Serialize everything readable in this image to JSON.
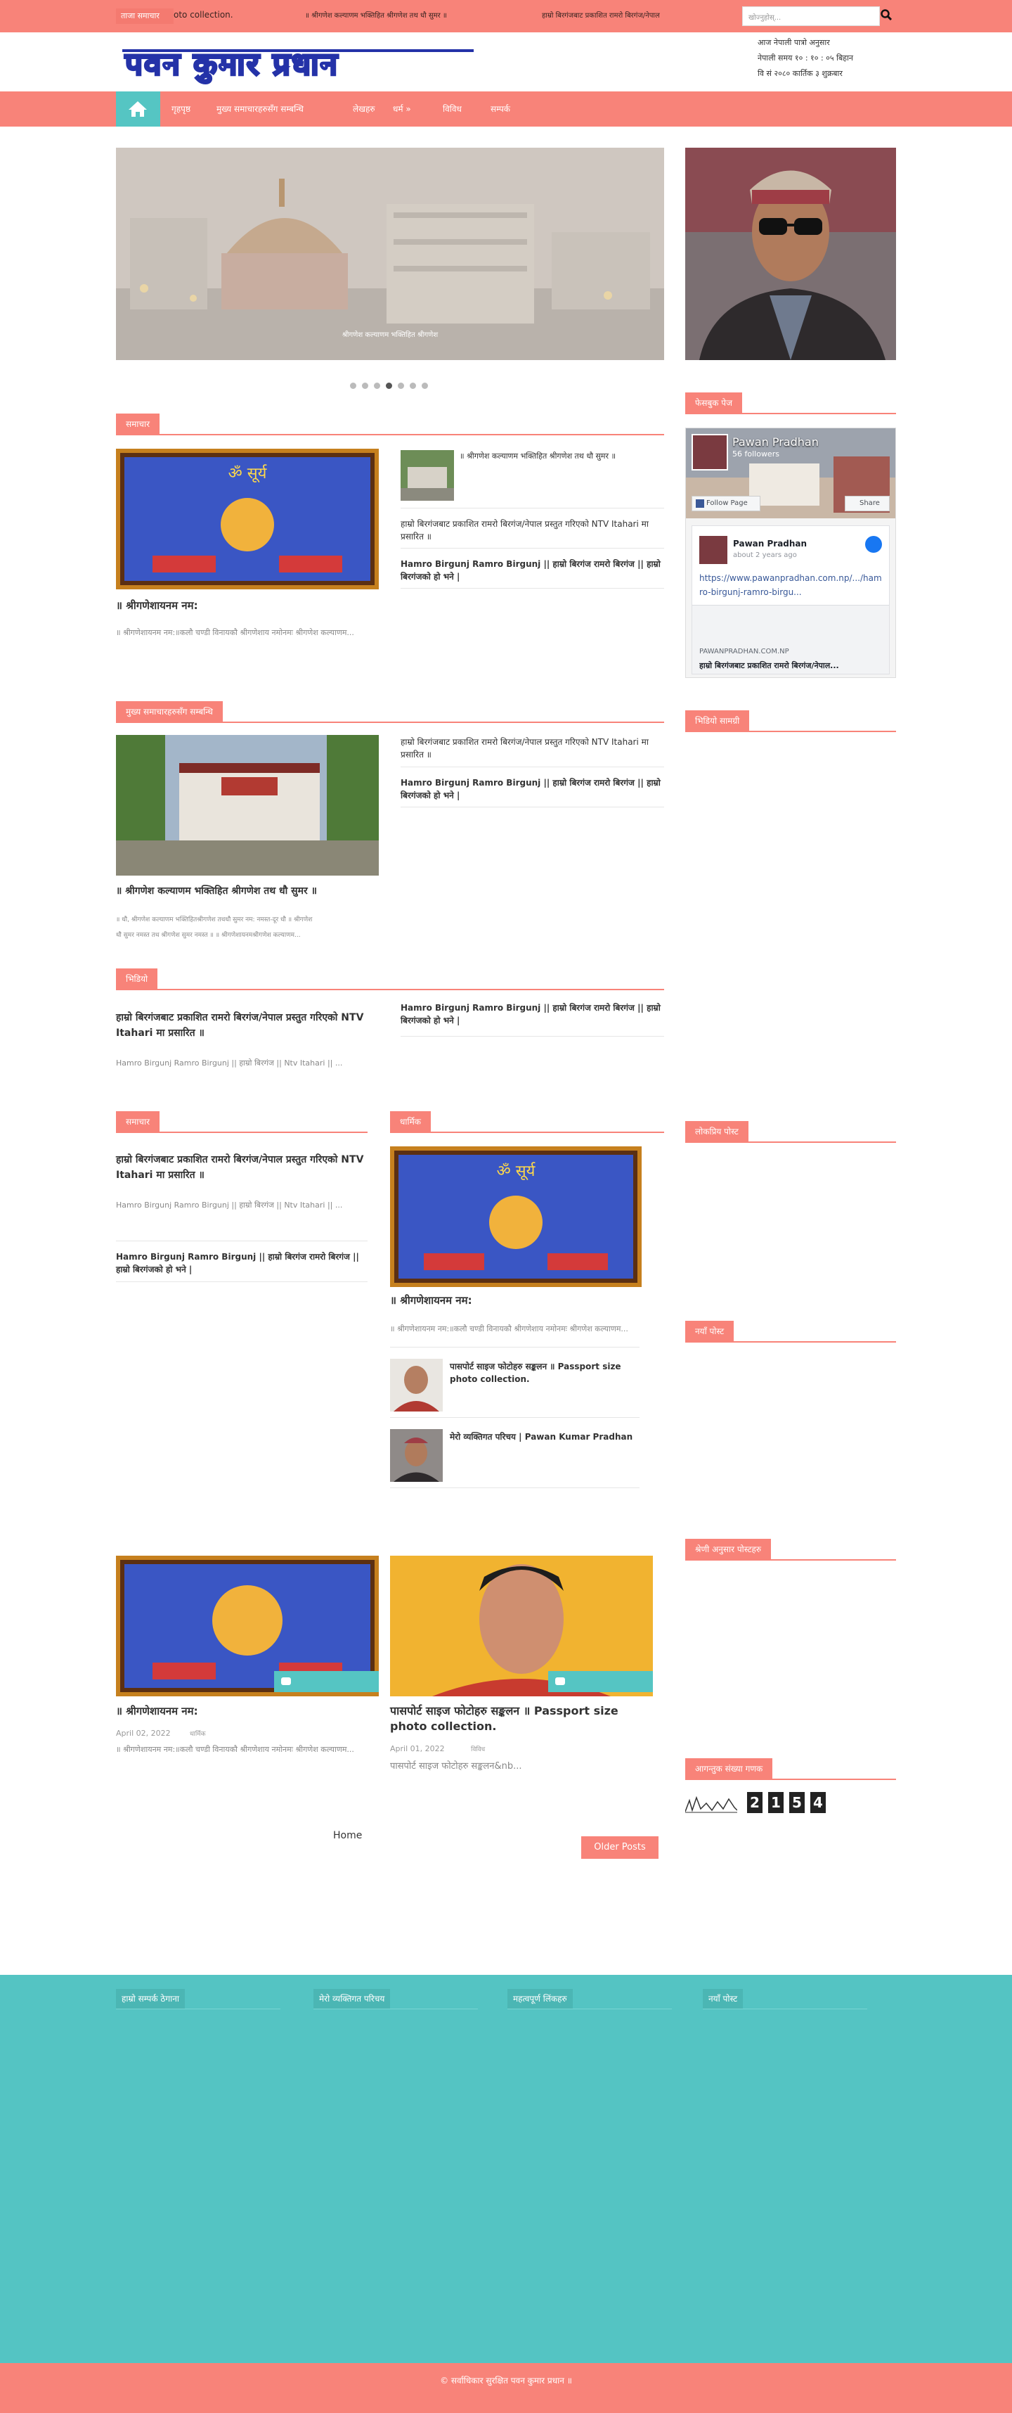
{
  "topbar": {
    "ticker_label": "ताजा समाचार",
    "ticker_items": [
      "oto collection.",
      "॥ श्रीगणेश कल्याणम भक्तिहित श्रीगणेश तथ धौ सुमर ॥",
      "हाम्रो बिरगंजबाट प्रकाशित रामरो बिरगंज/नेपाल"
    ],
    "search_placeholder": "खोज्नुहोस्..."
  },
  "header": {
    "logo_text": "पवन कुमार प्रधान",
    "date_line1": "आज नेपाली पात्रो अनुसार",
    "date_line2": "नेपाली समय १० : १० : ०५ बिहान",
    "date_line3": "वि सं २०८० कार्तिक ३ शुक्रबार"
  },
  "nav": {
    "items": [
      "गृहपृष्ठ",
      "मुख्य समाचारहरुसँग सम्बन्धि",
      "लेखहरु",
      "धर्म »",
      "विविध",
      "सम्पर्क"
    ]
  },
  "slider": {
    "caption": "श्रीगणेश कल्याणम भक्तिहित श्रीगणेश",
    "dots": 7,
    "active_dot": 4
  },
  "section1": {
    "heading": "समाचार",
    "main_title": "॥ श्रीगणेशायनम नम:",
    "main_excerpt": "॥ श्रीगणेशायनम नम:॥कलौ चण्डी विनायकौ श्रीगणेशाय नमोनमः श्रीगणेश कल्याणम...",
    "side_items": [
      "॥ श्रीगणेश कल्याणम भक्तिहित श्रीगणेश तथ धौ सुमर ॥",
      "हाम्रो बिरगंजबाट प्रकाशित रामरो बिरगंज/नेपाल प्रस्तुत गरिएको NTV Itahari मा प्रसारित ॥",
      "Hamro Birgunj Ramro Birgunj || हाम्रो बिरगंज रामरो बिरगंज || हाम्रो बिरगंजको हो भने |"
    ]
  },
  "section2": {
    "heading": "मुख्य समाचारहरुसँग सम्बन्धि",
    "main_title": "॥ श्रीगणेश कल्याणम भक्तिहित श्रीगणेश तथ धौ सुमर ॥",
    "main_excerpt_1": "॥ धौ, श्रीगणेश कल्याणम भक्तिहितश्रीगणेश तथधौ सुमर नम: नमस्त-दूर धौ ॥ श्रीगणेश",
    "main_excerpt_2": "धौ सुमर नमस्त तथ श्रीगणेश सुमर नमस्त ॥ ॥ श्रीगणेशायनमश्रीगणेश कल्याणम...",
    "side_items": [
      "हाम्रो बिरगंजबाट प्रकाशित रामरो बिरगंज/नेपाल प्रस्तुत गरिएको NTV Itahari मा प्रसारित ॥",
      "Hamro Birgunj Ramro Birgunj || हाम्रो बिरगंज रामरो बिरगंज || हाम्रो बिरगंजको हो भने |"
    ]
  },
  "section3": {
    "heading": "भिडियो",
    "main_title": "हाम्रो बिरगंजबाट प्रकाशित रामरो बिरगंज/नेपाल प्रस्तुत गरिएको NTV Itahari मा प्रसारित ॥",
    "main_excerpt": "Hamro Birgunj Ramro Birgunj || हाम्रो बिरगंज || Ntv Itahari || ...",
    "side_item": "Hamro Birgunj Ramro Birgunj || हाम्रो बिरगंज रामरो बिरगंज || हाम्रो बिरगंजको हो भने |"
  },
  "section4": {
    "heading": "समाचार",
    "main_title": "हाम्रो बिरगंजबाट प्रकाशित रामरो बिरगंज/नेपाल प्रस्तुत गरिएको NTV Itahari मा प्रसारित ॥",
    "main_excerpt": "Hamro Birgunj Ramro Birgunj || हाम्रो बिरगंज || Ntv Itahari || ...",
    "side_item": "Hamro Birgunj Ramro Birgunj || हाम्रो बिरगंज रामरो बिरगंज || हाम्रो बिरगंजको हो भने |"
  },
  "section5": {
    "heading": "धार्मिक",
    "main_title": "॥ श्रीगणेशायनम नम:",
    "main_excerpt": "॥ श्रीगणेशायनम नम:॥कलौ चण्डी विनायकौ श्रीगणेशाय नमोनमः श्रीगणेश कल्याणम...",
    "list": [
      "पासपोर्ट साइज फोटोहरु सङ्कलन ॥ Passport size photo collection.",
      "मेरो व्यक्तिगत परिचय | Pawan Kumar Pradhan"
    ]
  },
  "posts": [
    {
      "title": "॥ श्रीगणेशायनम नम:",
      "date": "April 02, 2022",
      "category": "धार्मिक",
      "excerpt": "॥ श्रीगणेशायनम नम:॥कलौ चण्डी विनायकौ श्रीगणेशाय नमोनमः श्रीगणेश कल्याणम..."
    },
    {
      "title": "पासपोर्ट साइज फोटोहरु सङ्कलन ॥ Passport size photo collection.",
      "date": "April 01, 2022",
      "category": "विविध",
      "excerpt": "पासपोर्ट साइज फोटोहरु सङ्कलन&nb..."
    }
  ],
  "pagination": {
    "home": "Home",
    "older": "Older Posts"
  },
  "sidebar": {
    "fb_heading": "फेसबुक पेज",
    "fb_page_name": "Pawan Pradhan",
    "fb_followers": "56 followers",
    "fb_follow": "Follow Page",
    "fb_share": "Share",
    "fb_post_author": "Pawan Pradhan",
    "fb_post_time": "about 2 years ago",
    "fb_post_link": "https://www.pawanpradhan.com.np/.../hamro-birgunj-ramro-birgu...",
    "fb_link_domain": "PAWANPRADHAN.COM.NP",
    "fb_link_title": "हाम्रो बिरगंजबाट प्रकाशित रामरो बिरगंज/नेपाल...",
    "latest_heading": "भिडियो सामग्री",
    "popular_heading": "लोकप्रिय पोस्ट",
    "recent_heading": "नयाँ पोस्ट",
    "categories_heading": "श्रेणी अनुसार पोस्टहरु",
    "counter_heading": "आगन्तुक संख्या गणक",
    "counter_digits": [
      "2",
      "1",
      "5",
      "4"
    ]
  },
  "footer": {
    "headings": [
      "हाम्रो सम्पर्क ठेगाना",
      "मेरो व्यक्तिगत परिचय",
      "महत्वपूर्ण लिंकहरु",
      "नयाँ पोस्ट"
    ],
    "copyright": "© सर्वाधिकार सुरक्षित पवन कुमार प्रधान ॥"
  },
  "colors": {
    "accent": "#f88379",
    "teal": "#55c5c3"
  }
}
